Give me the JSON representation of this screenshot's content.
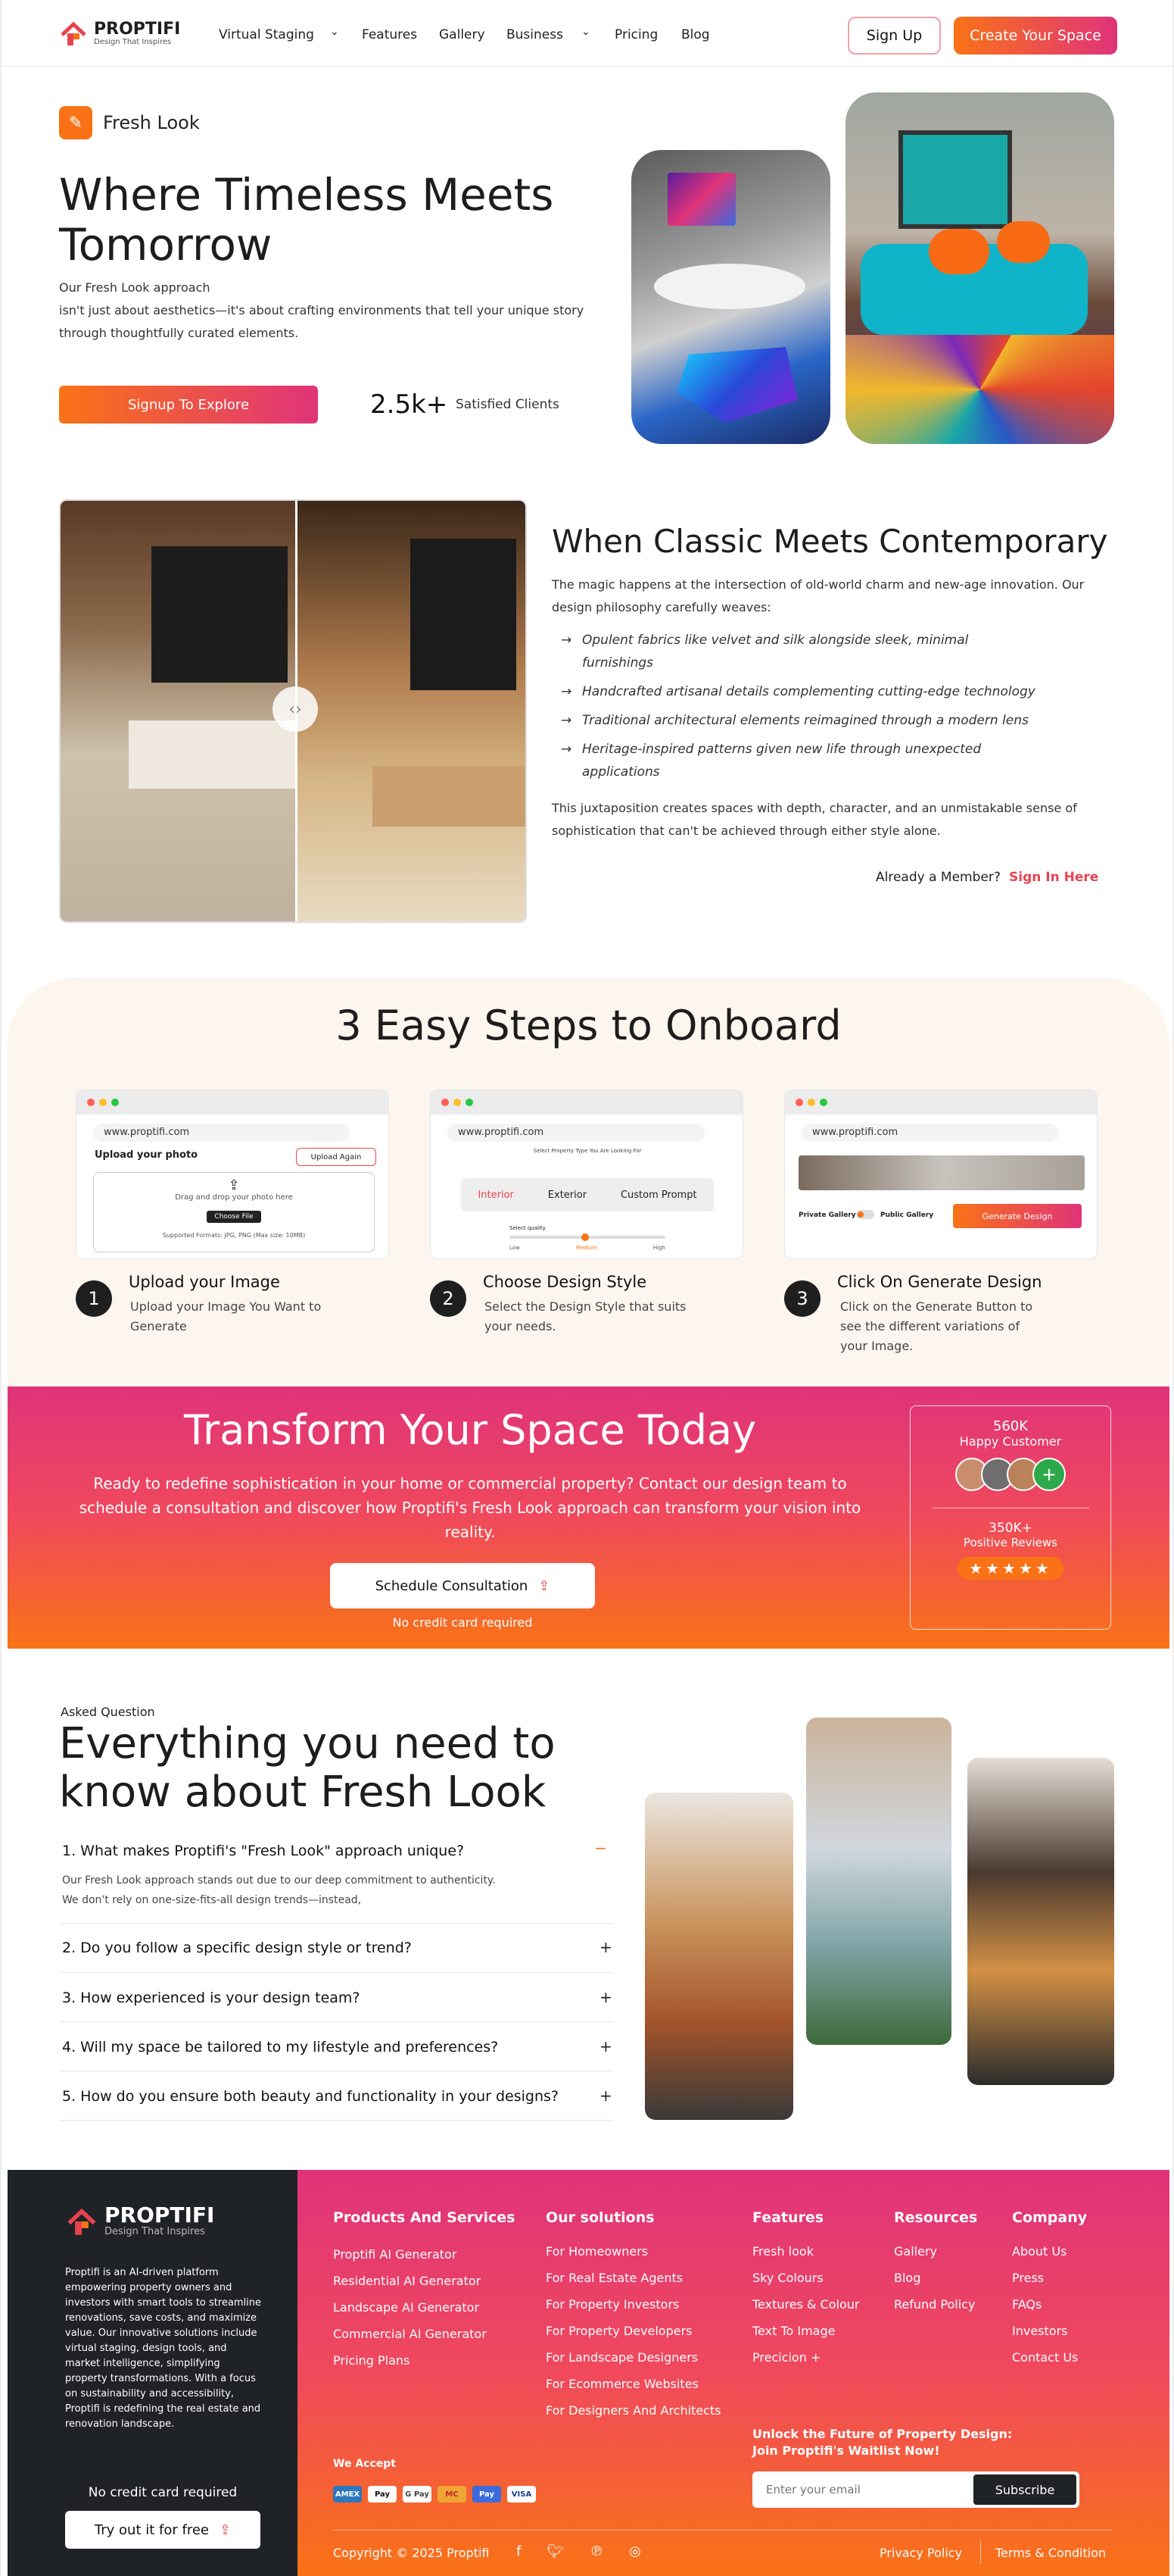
{
  "nav": {
    "brand": "PROPTIFI",
    "tagline": "Design That Inspires",
    "links": [
      "Virtual Staging",
      "Features",
      "Gallery",
      "Business",
      "Pricing",
      "Blog"
    ],
    "signup": "Sign Up",
    "create": "Create Your Space"
  },
  "hero": {
    "badge": "Fresh Look",
    "title": "Where Timeless Meets Tomorrow",
    "p1": "Our Fresh Look approach",
    "p2": "isn't just about aesthetics—it's about crafting environments that tell your unique story through thoughtfully curated elements.",
    "cta": "Signup To Explore",
    "stat_num": "2.5k+",
    "stat_label": "Satisfied Clients"
  },
  "classic": {
    "title": "When Classic Meets Contemporary",
    "intro": "The magic happens at the intersection of old-world charm and new-age innovation. Our design philosophy carefully weaves:",
    "items": [
      "Opulent fabrics like velvet and silk alongside sleek, minimal furnishings",
      "Handcrafted artisanal details complementing cutting-edge technology",
      "Traditional architectural elements reimagined through a modern lens",
      "Heritage-inspired patterns given new life through unexpected applications"
    ],
    "outro": "This juxtaposition creates spaces with depth, character, and an unmistakable sense of sophistication that can't be achieved through either style alone.",
    "member": "Already a Member?",
    "signin": "Sign In Here"
  },
  "steps": {
    "title": "3 Easy Steps to Onboard",
    "url": "www.proptifi.com",
    "items": [
      {
        "n": "1",
        "t": "Upload your Image",
        "d": "Upload your Image You Want to Generate"
      },
      {
        "n": "2",
        "t": "Choose Design Style",
        "d": "Select the Design Style that suits your needs."
      },
      {
        "n": "3",
        "t": "Click On Generate Design",
        "d": "Click on the Generate Button to see the different variations of your Image."
      }
    ],
    "s1": {
      "label": "Upload your photo",
      "btn": "Upload Again",
      "drag": "Drag and drop your photo here",
      "choose": "Choose File",
      "formats": "Supported Formats: JPG, PNG (Max size: 10MB)"
    },
    "s2": {
      "hint": "Select Property Type You Are Looking For",
      "tabs": [
        "Interior",
        "Exterior",
        "Custom Prompt"
      ],
      "quality": "Select quality",
      "low": "Low",
      "medium": "Medium",
      "high": "High"
    },
    "s3": {
      "private": "Private Gallery",
      "public": "Public Gallery",
      "gen": "Generate Design"
    }
  },
  "transform": {
    "title": "Transform Your Space Today",
    "text": "Ready to redefine sophistication in your home or commercial property?  Contact our design team to schedule a consultation and discover how Proptifi's Fresh Look approach can transform your vision into reality.",
    "btn": "Schedule Consultation",
    "note": "No credit card required",
    "stat1": "560K",
    "stat1_label": "Happy Customer",
    "stat2": "350K+",
    "stat2_label": "Positive Reviews",
    "stars": "★★★★★"
  },
  "faq": {
    "eyebrow": "Asked Question",
    "title": "Everything you need to know about Fresh Look",
    "items": [
      {
        "q": "1. What makes Proptifi's \"Fresh Look\" approach unique?",
        "a1": "Our Fresh Look approach stands out due to our deep commitment to authenticity.",
        "a2": "We don't rely on one-size-fits-all design trends—instead,"
      },
      {
        "q": "2. Do you follow a specific design style or trend?"
      },
      {
        "q": "3. How experienced is your design team?"
      },
      {
        "q": "4. Will my space be tailored to my lifestyle and preferences?"
      },
      {
        "q": "5. How do you ensure both beauty and functionality in your designs?"
      }
    ],
    "minus": "−",
    "plus": "+"
  },
  "footer": {
    "brand": "PROPTIFI",
    "tagline": "Design That Inspires",
    "about": "Proptifi is an AI-driven platform empowering property owners and investors with smart tools to streamline renovations, save costs, and maximize value. Our innovative solutions include virtual staging, design tools, and market intelligence, simplifying property transformations. With a focus on sustainability and accessibility, Proptifi is redefining the real estate and renovation landscape.",
    "no_cc": "No credit card required",
    "try": "Try out it for free",
    "cols": [
      {
        "h": "Products And Services",
        "l": [
          "Proptifi AI Generator",
          "Residential AI Generator",
          "Landscape AI Generator",
          "Commercial AI Generator",
          "Pricing Plans"
        ]
      },
      {
        "h": "Our solutions",
        "l": [
          "For Homeowners",
          "For Real Estate Agents",
          "For Property Investors",
          "For Property Developers",
          "For Landscape Designers",
          "For Ecommerce Websites",
          "For Designers And Architects"
        ]
      },
      {
        "h": "Features",
        "l": [
          "Fresh look",
          "Sky Colours",
          "Textures & Colour",
          "Text To Image",
          "Precicion +"
        ]
      },
      {
        "h": "Resources",
        "l": [
          "Gallery",
          "Blog",
          "Refund Policy"
        ]
      },
      {
        "h": "Company",
        "l": [
          "About Us",
          "Press",
          "FAQs",
          "Investors",
          "Contact Us"
        ]
      }
    ],
    "accept": "We Accept",
    "pays": [
      "AMEX",
      "Pay",
      "G Pay",
      "MC",
      "Pay",
      "VISA"
    ],
    "waitlist1": "Unlock the Future of Property Design:",
    "waitlist2": "Join Proptifi's Waitlist Now!",
    "email_ph": "Enter your email",
    "subscribe": "Subscribe",
    "copyright": "Copyright © 2025 Proptifi",
    "privacy": "Privacy Policy",
    "terms": "Terms & Condition"
  },
  "colors": {
    "orange": "#f97316",
    "pink": "#e0337a",
    "dark": "#1f2226"
  }
}
